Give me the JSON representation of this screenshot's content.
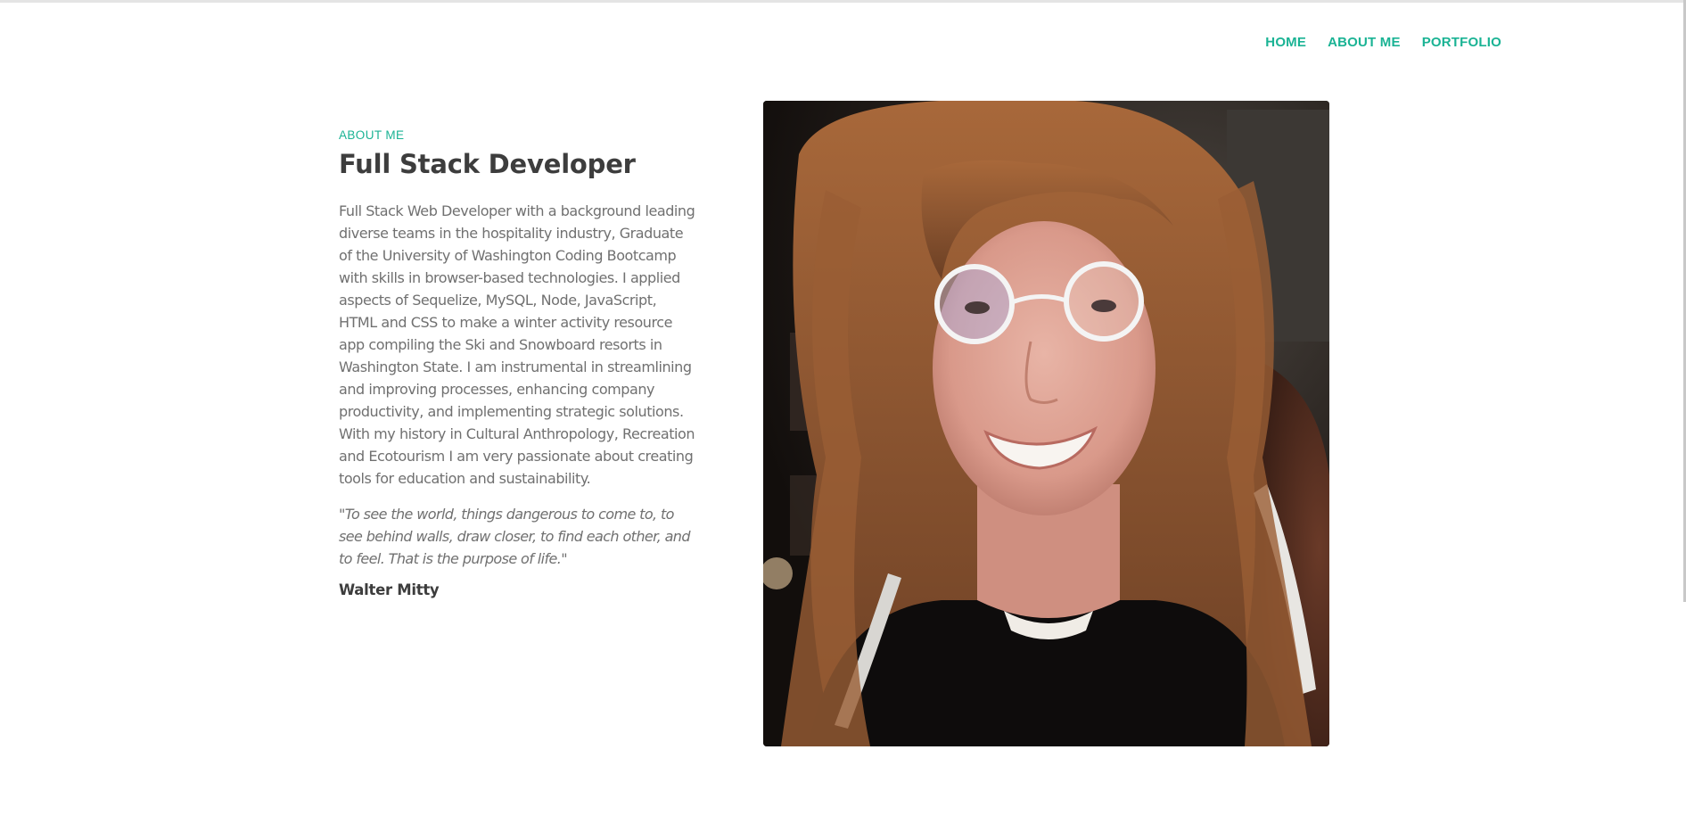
{
  "nav": {
    "items": [
      {
        "label": "HOME"
      },
      {
        "label": "ABOUT ME"
      },
      {
        "label": "PORTFOLIO"
      }
    ]
  },
  "about": {
    "eyebrow": "ABOUT ME",
    "title": "Full Stack Developer",
    "bio": "Full Stack Web Developer with a background leading diverse teams in the hospitality industry, Graduate of the University of Washington Coding Bootcamp with skills in browser-based technologies. I applied aspects of Sequelize, MySQL, Node, JavaScript, HTML and CSS to make a winter activity resource app compiling the Ski and Snowboard resorts in Washington State. I am instrumental in streamlining and improving processes, enhancing company productivity, and implementing strategic solutions. With my history in Cultural Anthropology, Recreation and Ecotourism I am very passionate about creating tools for education and sustainability.",
    "quote": "\"To see the world, things dangerous to come to, to see behind walls, draw closer, to find each other, and to feel. That is the purpose of life.\"",
    "quote_author": "Walter Mitty"
  },
  "colors": {
    "accent": "#1ab394",
    "heading": "#3d3d3d",
    "body_text": "#707070"
  }
}
